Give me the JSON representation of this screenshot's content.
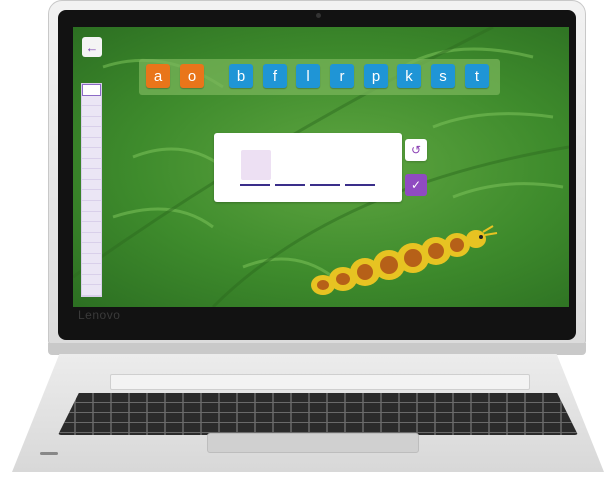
{
  "device": {
    "brand": "Lenovo"
  },
  "app": {
    "back_icon": "arrow-left-icon",
    "progress": {
      "total_steps": 20,
      "current_step": 1
    },
    "letter_tiles": [
      {
        "letter": "a",
        "kind": "vowel"
      },
      {
        "letter": "o",
        "kind": "vowel"
      },
      {
        "letter": "b",
        "kind": "consonant"
      },
      {
        "letter": "f",
        "kind": "consonant"
      },
      {
        "letter": "l",
        "kind": "consonant"
      },
      {
        "letter": "r",
        "kind": "consonant"
      },
      {
        "letter": "p",
        "kind": "consonant"
      },
      {
        "letter": "k",
        "kind": "consonant"
      },
      {
        "letter": "s",
        "kind": "consonant"
      },
      {
        "letter": "t",
        "kind": "consonant"
      }
    ],
    "word_card": {
      "blanks": 4
    },
    "replay_icon": "replay-icon",
    "check_icon": "checkmark-icon"
  },
  "colors": {
    "vowel_tile": "#e9751a",
    "consonant_tile": "#1f95d6",
    "accent_purple": "#8f4bc1",
    "leaf_green": "#3e8b2c"
  }
}
